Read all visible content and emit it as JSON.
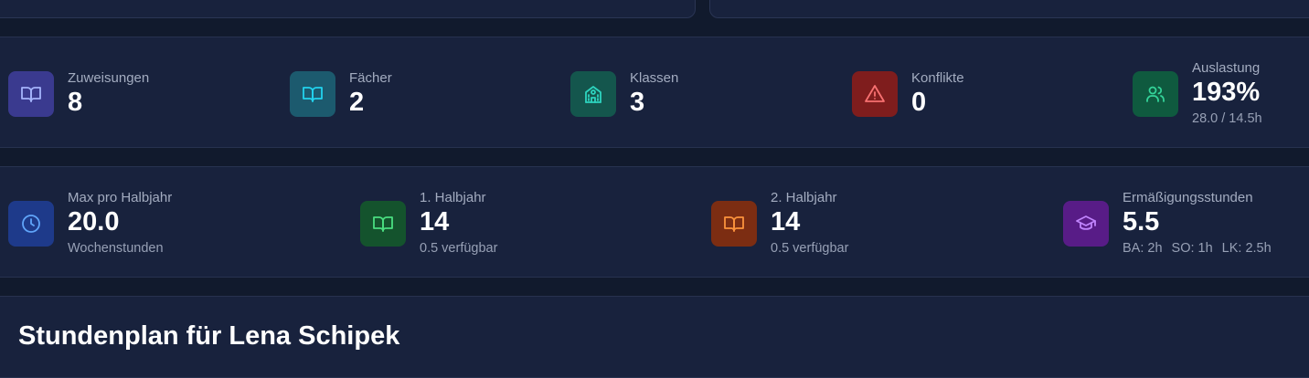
{
  "row1": [
    {
      "label": "Zuweisungen",
      "value": "8",
      "icon": "book-icon",
      "bg": "#3a3a8f",
      "fg": "#a5b4fc"
    },
    {
      "label": "Fächer",
      "value": "2",
      "icon": "book-icon",
      "bg": "#1c5a6e",
      "fg": "#22d3ee"
    },
    {
      "label": "Klassen",
      "value": "3",
      "icon": "school-icon",
      "bg": "#14564d",
      "fg": "#2dd4bf"
    },
    {
      "label": "Konflikte",
      "value": "0",
      "icon": "warning-icon",
      "bg": "#7f1d1d",
      "fg": "#f87171"
    },
    {
      "label": "Auslastung",
      "value": "193%",
      "sub": "28.0 / 14.5h",
      "icon": "users-icon",
      "bg": "#0f5a3f",
      "fg": "#34d399"
    }
  ],
  "row2": [
    {
      "label": "Max pro Halbjahr",
      "value": "20.0",
      "sub": "Wochenstunden",
      "icon": "clock-icon",
      "bg": "#1e3a8a",
      "fg": "#60a5fa"
    },
    {
      "label": "1. Halbjahr",
      "value": "14",
      "sub": "0.5 verfügbar",
      "icon": "book-icon",
      "bg": "#14532d",
      "fg": "#4ade80"
    },
    {
      "label": "2. Halbjahr",
      "value": "14",
      "sub": "0.5 verfügbar",
      "icon": "book-icon",
      "bg": "#7c2d12",
      "fg": "#fb923c"
    },
    {
      "label": "Ermäßigungsstunden",
      "value": "5.5",
      "sub_parts": [
        "BA: 2h",
        "SO: 1h",
        "LK: 2.5h"
      ],
      "icon": "graduation-cap-icon",
      "bg": "#581c87",
      "fg": "#c084fc"
    }
  ],
  "schedule": {
    "title": "Stundenplan für Lena Schipek"
  }
}
